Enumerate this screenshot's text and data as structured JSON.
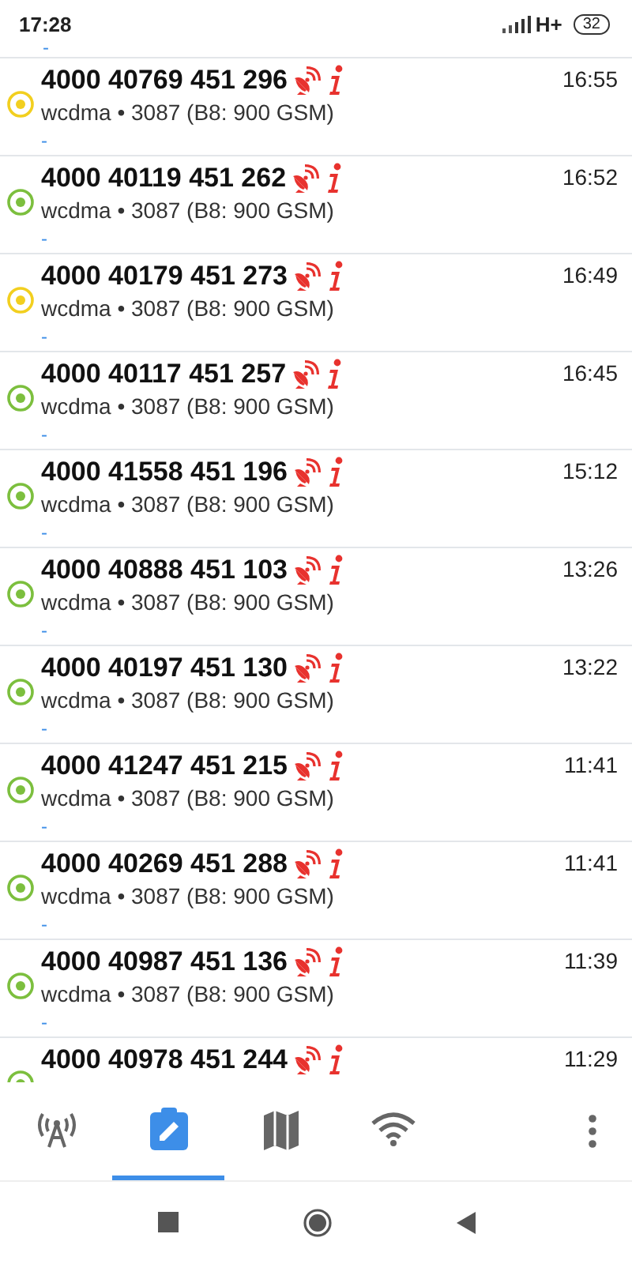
{
  "status_bar": {
    "time": "17:28",
    "network": "H+",
    "battery": "32"
  },
  "top_partial": {
    "note": "-"
  },
  "cells": [
    {
      "id": "4000 40769 451 296",
      "time": "16:55",
      "info": "wcdma • 3087 (B8: 900 GSM)",
      "note": "-",
      "color": "#f2cf1f"
    },
    {
      "id": "4000 40119 451 262",
      "time": "16:52",
      "info": "wcdma • 3087 (B8: 900 GSM)",
      "note": "-",
      "color": "#7cbf3e"
    },
    {
      "id": "4000 40179 451 273",
      "time": "16:49",
      "info": "wcdma • 3087 (B8: 900 GSM)",
      "note": "-",
      "color": "#f2cf1f"
    },
    {
      "id": "4000 40117 451 257",
      "time": "16:45",
      "info": "wcdma • 3087 (B8: 900 GSM)",
      "note": "-",
      "color": "#7cbf3e"
    },
    {
      "id": "4000 41558 451 196",
      "time": "15:12",
      "info": "wcdma • 3087 (B8: 900 GSM)",
      "note": "-",
      "color": "#7cbf3e"
    },
    {
      "id": "4000 40888 451 103",
      "time": "13:26",
      "info": "wcdma • 3087 (B8: 900 GSM)",
      "note": "-",
      "color": "#7cbf3e"
    },
    {
      "id": "4000 40197 451 130",
      "time": "13:22",
      "info": "wcdma • 3087 (B8: 900 GSM)",
      "note": "-",
      "color": "#7cbf3e"
    },
    {
      "id": "4000 41247 451 215",
      "time": "11:41",
      "info": "wcdma • 3087 (B8: 900 GSM)",
      "note": "-",
      "color": "#7cbf3e"
    },
    {
      "id": "4000 40269 451 288",
      "time": "11:41",
      "info": "wcdma • 3087 (B8: 900 GSM)",
      "note": "-",
      "color": "#7cbf3e"
    },
    {
      "id": "4000 40987 451 136",
      "time": "11:39",
      "info": "wcdma • 3087 (B8: 900 GSM)",
      "note": "-",
      "color": "#7cbf3e"
    },
    {
      "id": "4000 40978 451 244",
      "time": "11:29",
      "color": "#7cbf3e"
    }
  ],
  "bottom_tabs": [
    {
      "kind": "tower",
      "selected": false
    },
    {
      "kind": "log",
      "selected": true
    },
    {
      "kind": "map",
      "selected": false
    },
    {
      "kind": "wifi",
      "selected": false
    }
  ],
  "nav_buttons": [
    {
      "kind": "recents"
    },
    {
      "kind": "home"
    },
    {
      "kind": "back"
    }
  ]
}
